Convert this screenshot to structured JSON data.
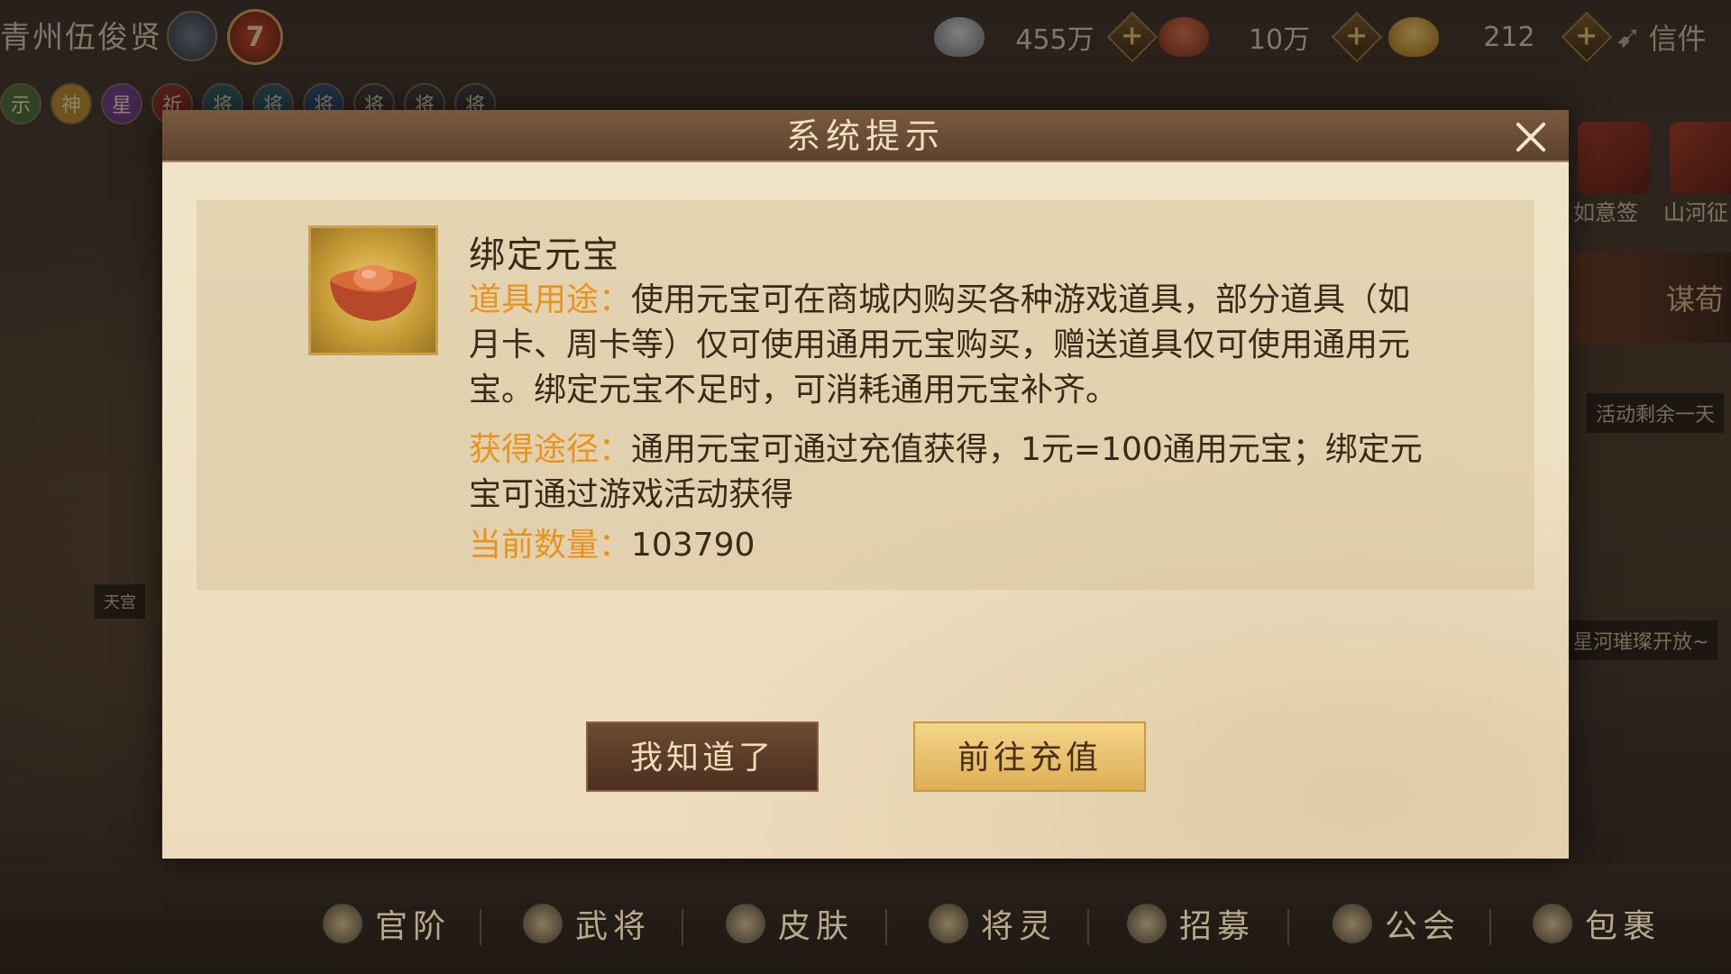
{
  "top_bar": {
    "player_name": "青州伍俊贤",
    "level": "7",
    "currencies": [
      {
        "name": "silver-ingot-icon",
        "value": "455万"
      },
      {
        "name": "red-ingot-icon",
        "value": "10万"
      },
      {
        "name": "gold-ingot-icon",
        "value": "212"
      }
    ],
    "plus_symbol": "+",
    "mail_label": "信件"
  },
  "badges": [
    "示",
    "神",
    "星",
    "祈",
    "将",
    "将",
    "将",
    "将",
    "将",
    "将"
  ],
  "side_panel": {
    "item1_label": "如意签",
    "item2_label": "山河征",
    "banner_text": "谋荀",
    "event_remaining": "活动剩余一天",
    "event_notice": "星河璀璨开放~",
    "tianji_label": "天宫"
  },
  "dialog": {
    "title": "系统提示",
    "item_name": "绑定元宝",
    "usage_label": "道具用途：",
    "usage_text": "使用元宝可在商城内购买各种游戏道具，部分道具（如月卡、周卡等）仅可使用通用元宝购买，赠送道具仅可使用通用元宝。绑定元宝不足时，可消耗通用元宝补齐。",
    "obtain_label": "获得途径：",
    "obtain_text": "通用元宝可通过充值获得，1元=100通用元宝；绑定元宝可通过游戏活动获得",
    "count_label": "当前数量：",
    "count_value": "103790",
    "ok_button": "我知道了",
    "recharge_button": "前往充值"
  },
  "bottom_nav": [
    {
      "label": "官阶",
      "icon": "rank-icon"
    },
    {
      "label": "武将",
      "icon": "general-icon"
    },
    {
      "label": "皮肤",
      "icon": "skin-icon"
    },
    {
      "label": "将灵",
      "icon": "spirit-icon"
    },
    {
      "label": "招募",
      "icon": "recruit-icon"
    },
    {
      "label": "公会",
      "icon": "guild-icon"
    },
    {
      "label": "包裹",
      "icon": "bag-icon"
    }
  ],
  "colors": {
    "accent_label": "#e8941c",
    "dialog_bg": "#ece0c6",
    "header_bg": "#5c4230"
  }
}
